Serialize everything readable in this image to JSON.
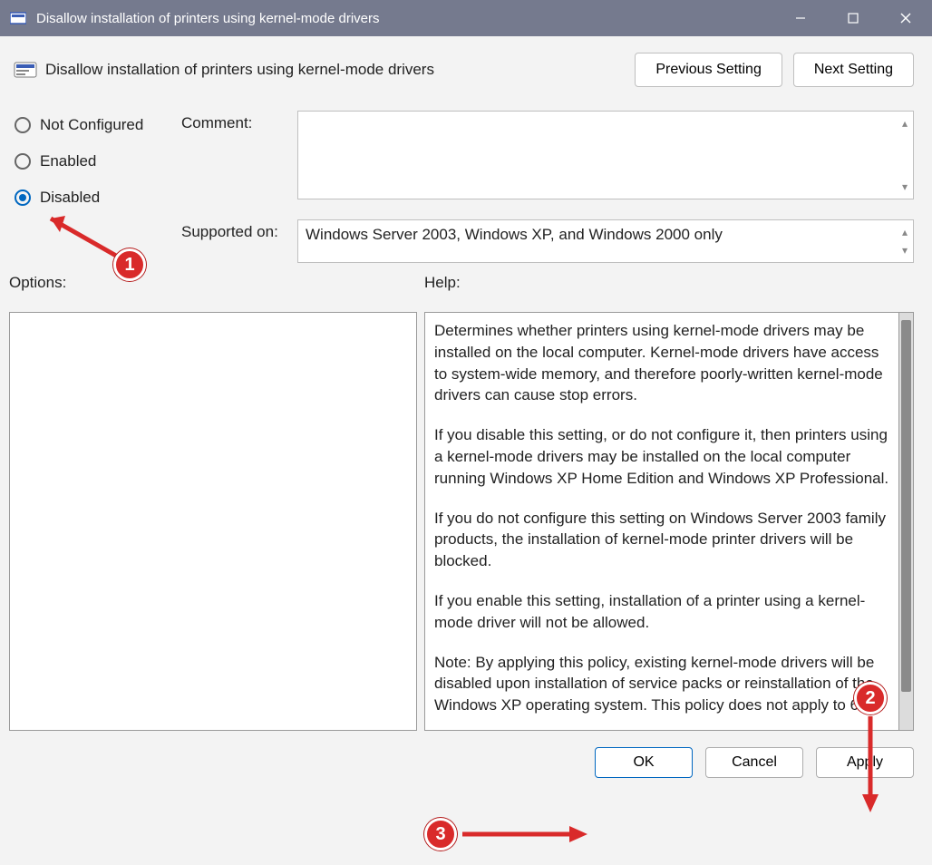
{
  "window": {
    "title": "Disallow installation of printers using kernel-mode drivers"
  },
  "header": {
    "policy_name": "Disallow installation of printers using kernel-mode drivers",
    "prev_btn": "Previous Setting",
    "next_btn": "Next Setting"
  },
  "radios": {
    "not_configured": "Not Configured",
    "enabled": "Enabled",
    "disabled": "Disabled",
    "selected": "disabled"
  },
  "fields": {
    "comment_label": "Comment:",
    "comment_value": "",
    "supported_label": "Supported on:",
    "supported_value": "Windows Server 2003, Windows XP, and Windows 2000 only"
  },
  "panes": {
    "options_label": "Options:",
    "help_label": "Help:",
    "help_p1": "Determines whether printers using kernel-mode drivers may be installed on the local computer.  Kernel-mode drivers have access to system-wide memory, and therefore poorly-written kernel-mode drivers can cause stop errors.",
    "help_p2": "If you disable this setting, or do not configure it, then printers using a kernel-mode drivers may be installed on the local computer running Windows XP Home Edition and Windows XP Professional.",
    "help_p3": "If you do not configure this setting on Windows Server 2003 family products, the installation of kernel-mode printer drivers will be blocked.",
    "help_p4": "If you enable this setting, installation of a printer using a kernel-mode driver will not be allowed.",
    "help_p5": "Note: By applying this policy, existing kernel-mode drivers will be disabled upon installation of service packs or reinstallation of the Windows XP operating system. This policy does not apply to 64-"
  },
  "footer": {
    "ok": "OK",
    "cancel": "Cancel",
    "apply": "Apply"
  },
  "annotations": {
    "b1": "1",
    "b2": "2",
    "b3": "3"
  }
}
